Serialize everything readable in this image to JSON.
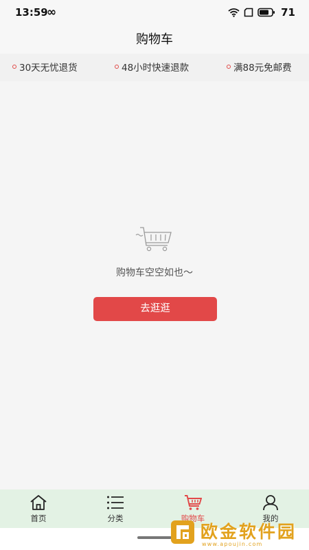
{
  "status_bar": {
    "time": "13:59",
    "battery_level": "71"
  },
  "header": {
    "title": "购物车"
  },
  "promos": [
    {
      "text": "30天无忧退货"
    },
    {
      "text": "48小时快速退款"
    },
    {
      "text": "满88元免邮费"
    }
  ],
  "empty_state": {
    "message": "购物车空空如也～",
    "button_label": "去逛逛"
  },
  "tabs": [
    {
      "label": "首页",
      "icon": "home-icon"
    },
    {
      "label": "分类",
      "icon": "list-icon"
    },
    {
      "label": "购物车",
      "icon": "cart-icon",
      "active": true
    },
    {
      "label": "我的",
      "icon": "user-icon"
    }
  ],
  "colors": {
    "accent": "#e24848",
    "tab_bar_bg": "#e3f2e4",
    "page_bg": "#f5f5f5"
  },
  "watermark": {
    "title": "欧金软件园",
    "url": "www.apoujin.com"
  }
}
